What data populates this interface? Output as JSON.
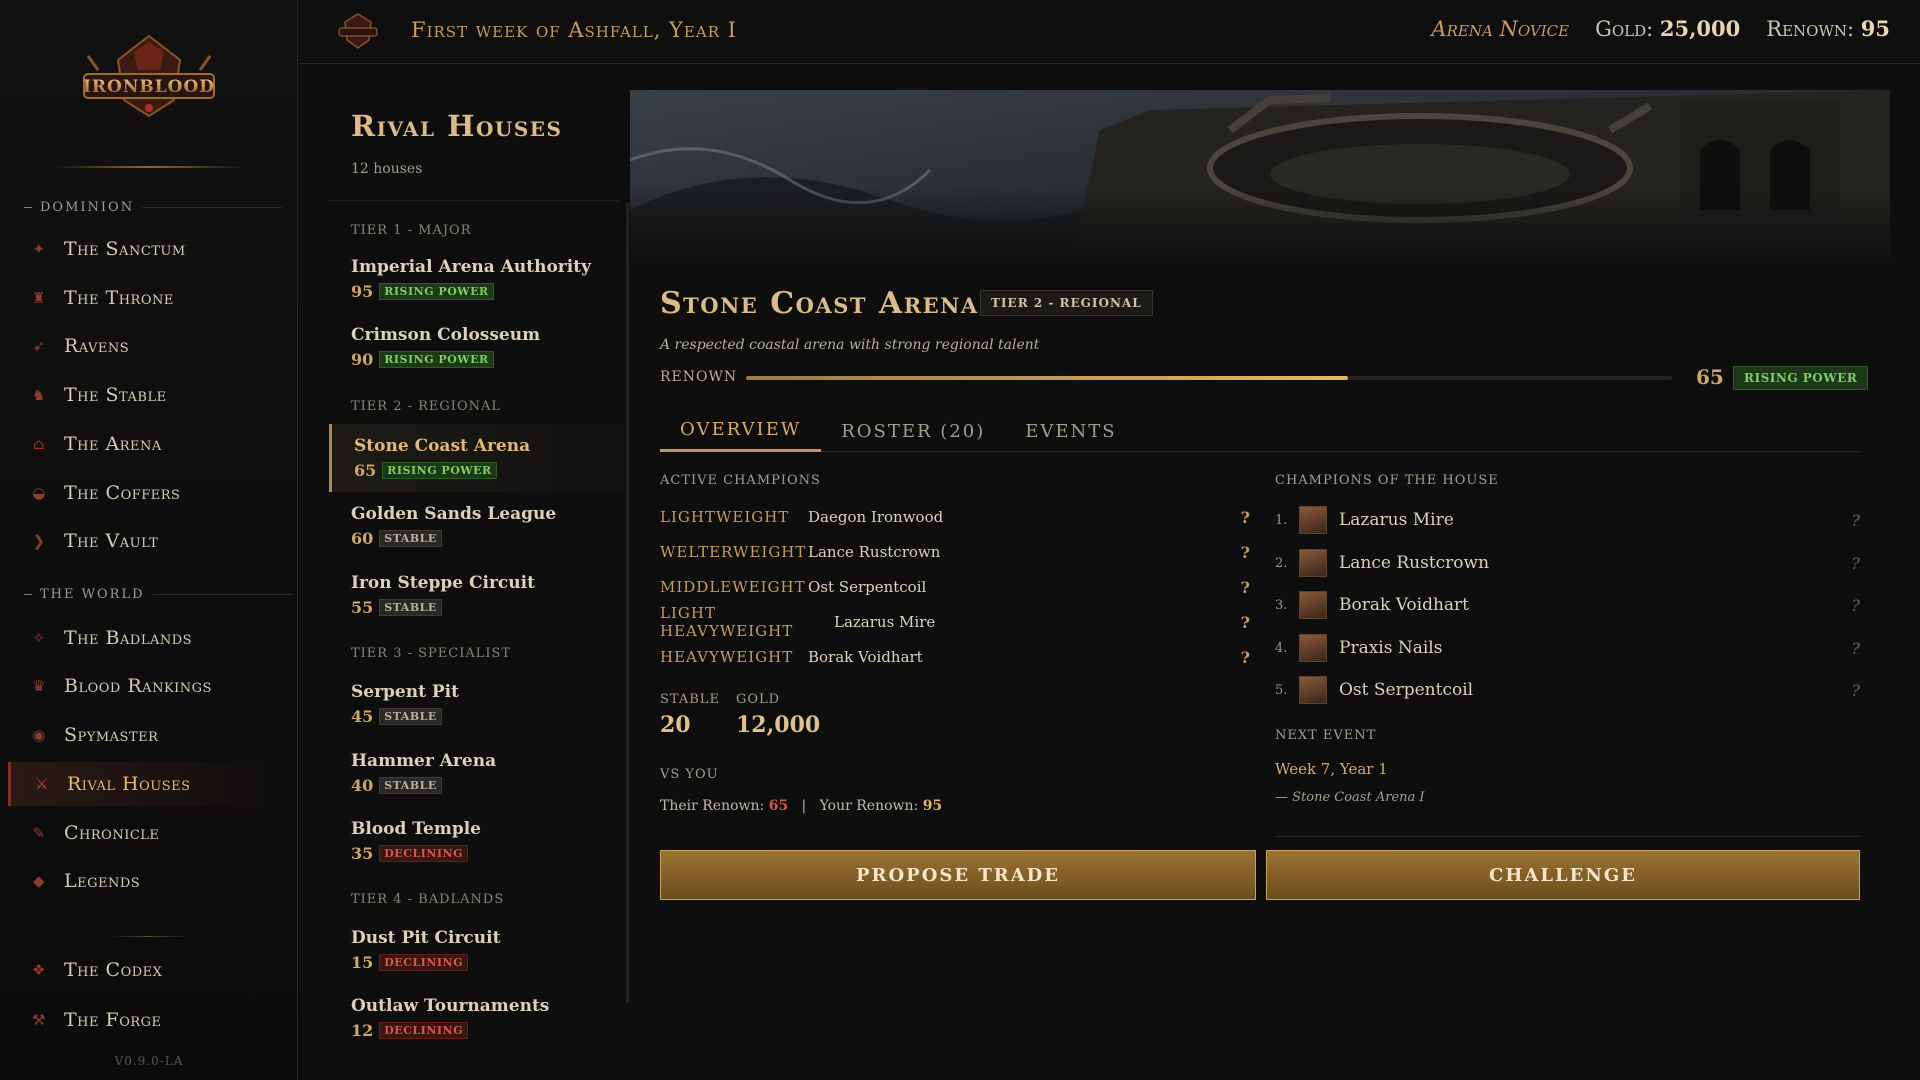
{
  "app": {
    "logo_text": "IRONBLOOD",
    "version": "V0.9.0-LA"
  },
  "topbar": {
    "date": "First week of Ashfall, Year I",
    "rank": "Arena Novice",
    "gold_label": "Gold:",
    "gold_value": "25,000",
    "renown_label": "Renown:",
    "renown_value": "95"
  },
  "sidebar": {
    "sections": [
      {
        "label": "DOMINION"
      },
      {
        "label": "THE WORLD"
      }
    ],
    "items": [
      {
        "label": "The Sanctum",
        "icon": "sanctum-icon"
      },
      {
        "label": "The Throne",
        "icon": "throne-icon"
      },
      {
        "label": "Ravens",
        "icon": "raven-icon"
      },
      {
        "label": "The Stable",
        "icon": "stable-icon"
      },
      {
        "label": "The Arena",
        "icon": "arena-icon"
      },
      {
        "label": "The Coffers",
        "icon": "coffers-icon"
      },
      {
        "label": "The Vault",
        "icon": "vault-icon"
      },
      {
        "label": "The Badlands",
        "icon": "badlands-icon"
      },
      {
        "label": "Blood Rankings",
        "icon": "trophy-icon"
      },
      {
        "label": "Spymaster",
        "icon": "eye-icon"
      },
      {
        "label": "Rival Houses",
        "icon": "crossed-swords-icon"
      },
      {
        "label": "Chronicle",
        "icon": "quill-icon"
      },
      {
        "label": "Legends",
        "icon": "star-icon"
      },
      {
        "label": "The Codex",
        "icon": "book-icon"
      },
      {
        "label": "The Forge",
        "icon": "hammer-icon"
      }
    ],
    "active": "Rival Houses"
  },
  "rivals": {
    "title": "Rival Houses",
    "count": "12 houses",
    "tiers": [
      {
        "label": "TIER 1 - MAJOR"
      },
      {
        "label": "TIER 2 - REGIONAL"
      },
      {
        "label": "TIER 3 - SPECIALIST"
      },
      {
        "label": "TIER 4 - BADLANDS"
      }
    ],
    "houses": [
      {
        "name": "Imperial Arena Authority",
        "renown": "95",
        "status": "RISING POWER"
      },
      {
        "name": "Crimson Colosseum",
        "renown": "90",
        "status": "RISING POWER"
      },
      {
        "name": "Stone Coast Arena",
        "renown": "65",
        "status": "RISING POWER"
      },
      {
        "name": "Golden Sands League",
        "renown": "60",
        "status": "STABLE"
      },
      {
        "name": "Iron Steppe Circuit",
        "renown": "55",
        "status": "STABLE"
      },
      {
        "name": "Serpent Pit",
        "renown": "45",
        "status": "STABLE"
      },
      {
        "name": "Hammer Arena",
        "renown": "40",
        "status": "STABLE"
      },
      {
        "name": "Blood Temple",
        "renown": "35",
        "status": "DECLINING"
      },
      {
        "name": "Dust Pit Circuit",
        "renown": "15",
        "status": "DECLINING"
      },
      {
        "name": "Outlaw Tournaments",
        "renown": "12",
        "status": "DECLINING"
      }
    ]
  },
  "detail": {
    "name": "Stone Coast Arena",
    "tier": "TIER 2 - REGIONAL",
    "description": "A respected coastal arena with strong regional talent",
    "renown_label": "RENOWN",
    "renown_value": "65",
    "renown_fraction": 0.65,
    "renown_status": "RISING POWER",
    "tabs": [
      "OVERVIEW",
      "ROSTER (20)",
      "EVENTS"
    ],
    "active_champions_label": "ACTIVE CHAMPIONS",
    "weight_classes": [
      {
        "class": "LIGHTWEIGHT",
        "name": "Daegon Ironwood",
        "q": "?"
      },
      {
        "class": "WELTERWEIGHT",
        "name": "Lance Rustcrown",
        "q": "?"
      },
      {
        "class": "MIDDLEWEIGHT",
        "name": "Ost Serpentcoil",
        "q": "?"
      },
      {
        "class": "LIGHT HEAVYWEIGHT",
        "name": "Lazarus Mire",
        "q": "?"
      },
      {
        "class": "HEAVYWEIGHT",
        "name": "Borak Voidhart",
        "q": "?"
      }
    ],
    "stable_label": "STABLE",
    "stable_value": "20",
    "gold_label": "GOLD",
    "gold_value": "12,000",
    "vs_label": "VS YOU",
    "their_renown_label": "Their Renown:",
    "their_renown": "65",
    "sep": "|",
    "your_renown_label": "Your Renown:",
    "your_renown": "95",
    "champions_label": "CHAMPIONS OF THE HOUSE",
    "champions": [
      {
        "idx": "1.",
        "name": "Lazarus Mire",
        "q": "?"
      },
      {
        "idx": "2.",
        "name": "Lance Rustcrown",
        "q": "?"
      },
      {
        "idx": "3.",
        "name": "Borak Voidhart",
        "q": "?"
      },
      {
        "idx": "4.",
        "name": "Praxis Nails",
        "q": "?"
      },
      {
        "idx": "5.",
        "name": "Ost Serpentcoil",
        "q": "?"
      }
    ],
    "next_event_label": "NEXT EVENT",
    "next_event_date": "Week 7, Year 1",
    "next_event_loc": "— Stone Coast Arena I",
    "propose_trade": "PROPOSE TRADE",
    "challenge": "CHALLENGE"
  },
  "colors": {
    "accent_gold": "#c79c5e",
    "rising": "#7fcf5f",
    "declining": "#d8584a",
    "active_red": "#c9433a"
  }
}
